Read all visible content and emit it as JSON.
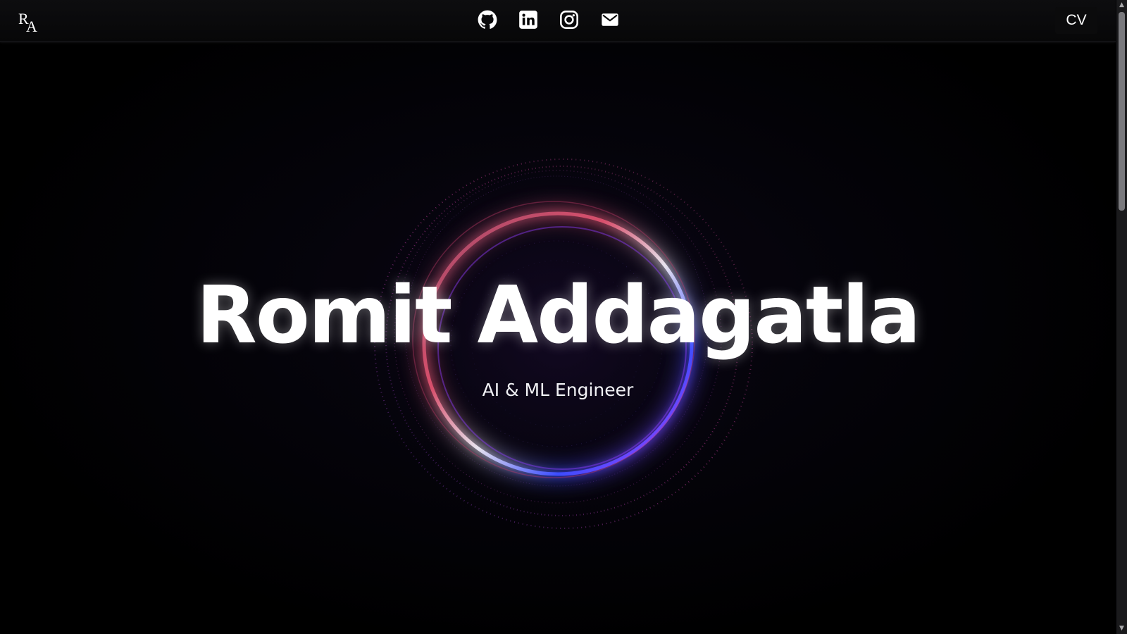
{
  "navbar": {
    "logo_text": "RA",
    "social": [
      {
        "icon": "github-icon",
        "label": "GitHub"
      },
      {
        "icon": "linkedin-icon",
        "label": "LinkedIn"
      },
      {
        "icon": "instagram-icon",
        "label": "Instagram"
      },
      {
        "icon": "mail-icon",
        "label": "Email"
      }
    ],
    "cv_label": "CV"
  },
  "hero": {
    "name": "Romit Addagatla",
    "subtitle": "AI & ML Engineer"
  },
  "scrollbar": {
    "up_arrow": "▲",
    "down_arrow": "▼"
  },
  "colors": {
    "background": "#000000",
    "ring_pink": "#e0457a",
    "ring_purple": "#8a3cff",
    "ring_blue": "#3a4cff",
    "text": "#ffffff"
  }
}
